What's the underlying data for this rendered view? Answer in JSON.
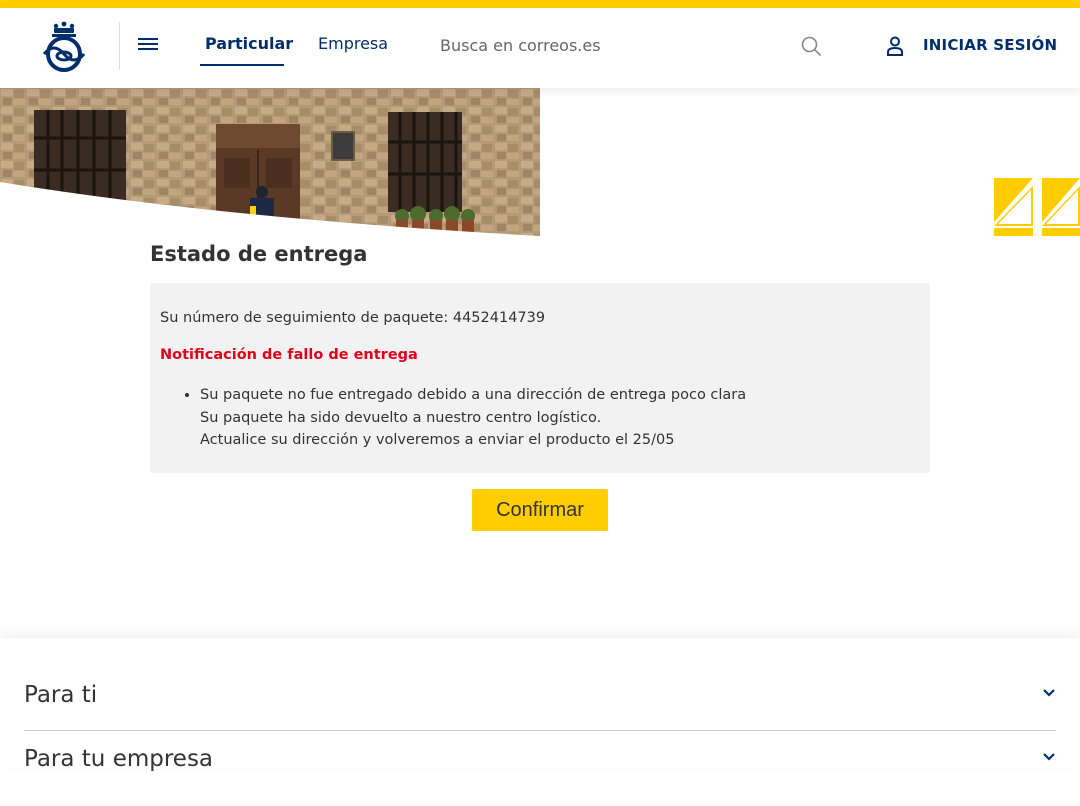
{
  "header": {
    "logo_alt": "Correos",
    "tabs": [
      {
        "label": "Particular",
        "active": true
      },
      {
        "label": "Empresa",
        "active": false
      }
    ],
    "search": {
      "placeholder": "Busca en correos.es"
    },
    "login_label": "INICIAR SESIÓN"
  },
  "main": {
    "title": "Estado de entrega",
    "tracking_text": "Su número de seguimiento de paquete: 4452414739",
    "notice_title": "Notificación de fallo de entrega",
    "bullets": [
      "Su paquete no fue entregado debido a una dirección de entrega poco clara",
      "Su paquete ha sido devuelto a nuestro centro logístico.",
      "Actualice su dirección y volveremos a enviar el producto el 25/05"
    ],
    "confirm_label": "Confirmar"
  },
  "footer": {
    "sections": [
      {
        "label": "Para ti"
      },
      {
        "label": "Para tu empresa"
      }
    ]
  },
  "colors": {
    "brand_yellow": "#ffcd00",
    "brand_blue": "#002e6d",
    "alert_red": "#e2001a",
    "panel_grey": "#f2f2f2"
  },
  "icons": [
    "correos-logo-icon",
    "menu-icon",
    "search-icon",
    "user-icon",
    "chevron-down-icon"
  ]
}
